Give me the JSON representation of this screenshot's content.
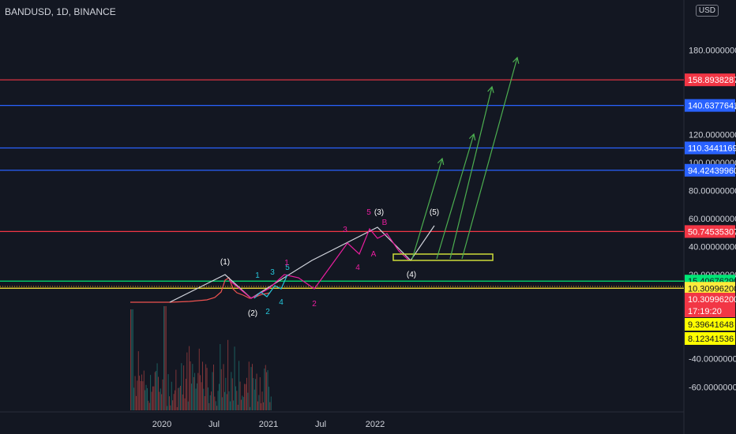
{
  "header": {
    "title": "BANDUSD, 1D, BINANCE",
    "currency": "USD"
  },
  "chart_data": {
    "type": "line",
    "symbol": "BANDUSD",
    "interval": "1D",
    "exchange": "BINANCE",
    "ylim": [
      -70,
      190
    ],
    "y_ticks": [
      180,
      140,
      120,
      100,
      80,
      60,
      40,
      20,
      0,
      -40,
      -60
    ],
    "y_tick_labels": [
      "180.00000000",
      "140.00000000",
      "120.00000000",
      "100.00000000",
      "80.00000000",
      "60.00000000",
      "40.00000000",
      "20.00000000",
      "0.00",
      "-40.00000000",
      "-60.00000000"
    ],
    "x_tick_labels": [
      "2020",
      "Jul",
      "2021",
      "Jul",
      "2022"
    ],
    "horizontal_levels": [
      {
        "value": 158.89382873,
        "label": "158.89382873",
        "color": "#f23645"
      },
      {
        "value": 140.63776418,
        "label": "140.63776418",
        "color": "#2962ff"
      },
      {
        "value": 110.34411692,
        "label": "110.34411692",
        "color": "#2962ff"
      },
      {
        "value": 94.4243996,
        "label": "94.42439960",
        "color": "#2962ff"
      },
      {
        "value": 50.74535307,
        "label": "50.74535307",
        "color": "#f23645"
      },
      {
        "value": 15.4067629,
        "label": "15.40676290",
        "color": "#00e676"
      },
      {
        "value": 10.309962,
        "label": "10.30996200",
        "color": "#ffeb3b"
      }
    ],
    "price_tags": [
      {
        "label": "10.30996200",
        "color": "#f23645"
      },
      {
        "label": "17:19:20",
        "color": "#f23645"
      },
      {
        "label": "9.39641648",
        "color": "#ffff00"
      },
      {
        "label": "8.12341536",
        "color": "#ffff00"
      }
    ],
    "wave_labels": [
      "(1)",
      "(2)",
      "(3)",
      "(4)",
      "(5)"
    ],
    "cyan_labels": [
      "1",
      "2",
      "3",
      "4",
      "5"
    ],
    "magenta_labels": [
      "1",
      "2",
      "3",
      "4",
      "5",
      "A",
      "B"
    ],
    "colors": {
      "bg": "#131722",
      "candle_up": "#26a69a",
      "candle_down": "#ef5350",
      "wave": "#d1d4dc",
      "pattern": "#e91e9f",
      "target": "#4caf50",
      "zone": "#cddc39"
    }
  }
}
